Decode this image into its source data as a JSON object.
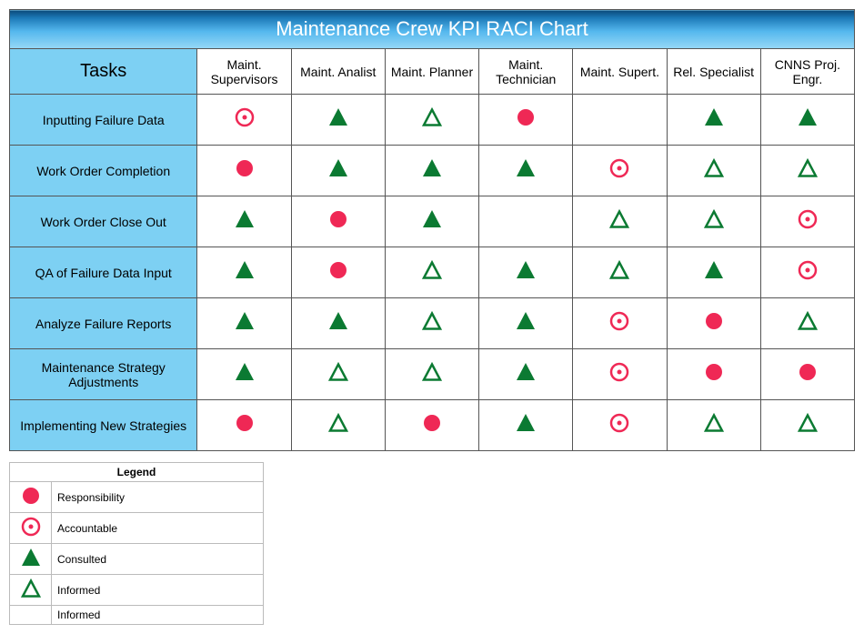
{
  "chart_data": {
    "type": "table",
    "title": "Maintenance Crew KPI RACI Chart",
    "tasks_header": "Tasks",
    "roles": [
      "Maint. Supervisors",
      "Maint. Analist",
      "Maint. Planner",
      "Maint. Technician",
      "Maint. Supert.",
      "Rel. Specialist",
      "CNNS Proj. Engr."
    ],
    "tasks": [
      "Inputting Failure Data",
      "Work Order Completion",
      "Work Order Close Out",
      "QA of Failure Data Input",
      "Analyze Failure Reports",
      "Maintenance Strategy Adjustments",
      "Implementing New Strategies"
    ],
    "matrix": [
      [
        "A",
        "C",
        "I",
        "R",
        "",
        "C",
        "C"
      ],
      [
        "R",
        "C",
        "C",
        "C",
        "A",
        "I",
        "I"
      ],
      [
        "C",
        "R",
        "C",
        "",
        "I",
        "I",
        "A"
      ],
      [
        "C",
        "R",
        "I",
        "C",
        "I",
        "C",
        "A"
      ],
      [
        "C",
        "C",
        "I",
        "C",
        "A",
        "R",
        "I"
      ],
      [
        "C",
        "I",
        "I",
        "C",
        "A",
        "R",
        "R"
      ],
      [
        "R",
        "I",
        "R",
        "C",
        "A",
        "I",
        "I"
      ]
    ],
    "symbols": {
      "R": {
        "name": "Responsibility",
        "shape": "circle-filled",
        "color": "#ef2855"
      },
      "A": {
        "name": "Accountable",
        "shape": "circle-outline-dot",
        "color": "#ef2855"
      },
      "C": {
        "name": "Consulted",
        "shape": "triangle-filled",
        "color": "#0b7a32"
      },
      "I": {
        "name": "Informed",
        "shape": "triangle-outline",
        "color": "#0b7a32"
      }
    }
  },
  "legend": {
    "title": "Legend",
    "items": [
      {
        "code": "R",
        "label": "Responsibility"
      },
      {
        "code": "A",
        "label": "Accountable"
      },
      {
        "code": "C",
        "label": "Consulted"
      },
      {
        "code": "I",
        "label": "Informed"
      },
      {
        "code": "",
        "label": "Informed"
      }
    ]
  }
}
